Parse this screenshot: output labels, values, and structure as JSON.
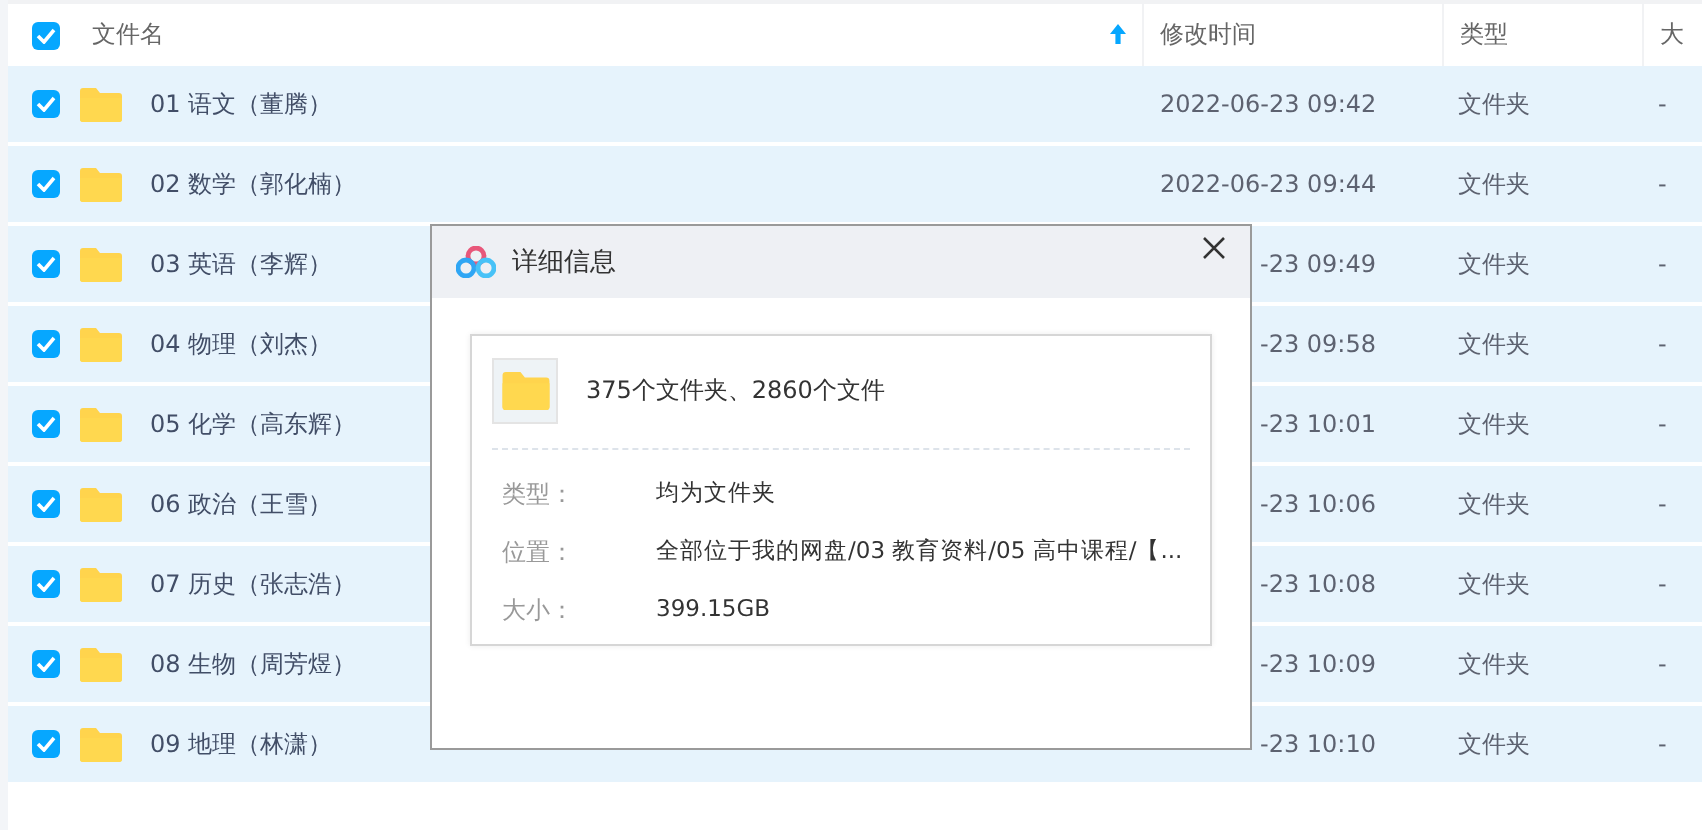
{
  "header": {
    "select_all_checked": true,
    "columns": [
      {
        "label": "文件名",
        "sorted": true
      },
      {
        "label": "修改时间",
        "sorted": false
      },
      {
        "label": "类型",
        "sorted": false
      },
      {
        "label": "大",
        "sorted": false
      }
    ]
  },
  "rows": [
    {
      "name": "01 语文（董腾）",
      "time": "2022-06-23 09:42",
      "type": "文件夹",
      "size": "-",
      "checked": true,
      "covered": false
    },
    {
      "name": "02 数学（郭化楠）",
      "time": "2022-06-23 09:44",
      "type": "文件夹",
      "size": "-",
      "checked": true,
      "covered": false
    },
    {
      "name": "03 英语（李辉）",
      "time": "-23 09:49",
      "type": "文件夹",
      "size": "-",
      "checked": true,
      "covered": true
    },
    {
      "name": "04 物理（刘杰）",
      "time": "-23 09:58",
      "type": "文件夹",
      "size": "-",
      "checked": true,
      "covered": true
    },
    {
      "name": "05 化学（高东辉）",
      "time": "-23 10:01",
      "type": "文件夹",
      "size": "-",
      "checked": true,
      "covered": true
    },
    {
      "name": "06 政治（王雪）",
      "time": "-23 10:06",
      "type": "文件夹",
      "size": "-",
      "checked": true,
      "covered": true
    },
    {
      "name": "07 历史（张志浩）",
      "time": "-23 10:08",
      "type": "文件夹",
      "size": "-",
      "checked": true,
      "covered": true
    },
    {
      "name": "08 生物（周芳煜）",
      "time": "-23 10:09",
      "type": "文件夹",
      "size": "-",
      "checked": true,
      "covered": true
    },
    {
      "name": "09 地理（林潇）",
      "time": "-23 10:10",
      "type": "文件夹",
      "size": "-",
      "checked": true,
      "covered": true
    }
  ],
  "dialog": {
    "title": "详细信息",
    "summary": "375个文件夹、2860个文件",
    "fields": [
      {
        "label": "类型：",
        "value": "均为文件夹"
      },
      {
        "label": "位置：",
        "value": "全部位于我的网盘/03 教育资料/05 高中课程/【..."
      },
      {
        "label": "大小：",
        "value": "399.15GB"
      }
    ]
  }
}
